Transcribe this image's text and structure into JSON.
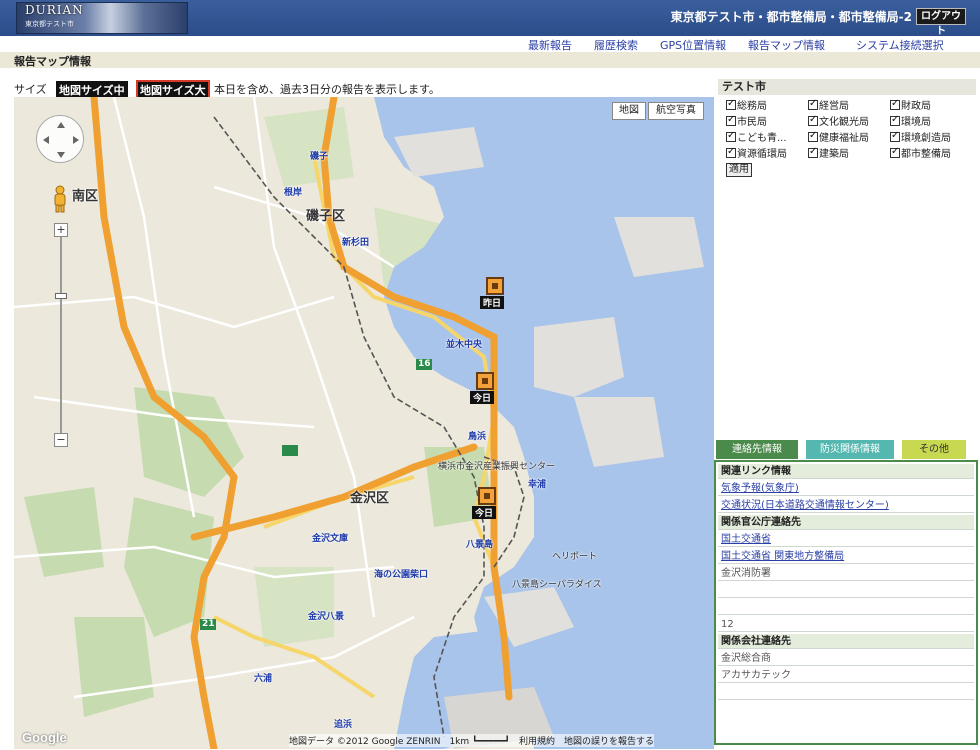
{
  "header": {
    "logo_text": "DURIAN",
    "logo_sub": "東京都テスト市",
    "title": "東京都テスト市・都市整備局・都市整備局-2",
    "logout": "ログアウト"
  },
  "nav": {
    "items": [
      "最新報告",
      "履歴検索",
      "GPS位置情報",
      "報告マップ情報",
      "システム接続選択"
    ]
  },
  "page_title": "報告マップ情報",
  "size_row": {
    "label": "サイズ",
    "medium": "地図サイズ中",
    "large": "地図サイズ大",
    "note": "本日を含め、過去3日分の報告を表示します。"
  },
  "map": {
    "toggle_map": "地図",
    "toggle_satellite": "航空写真",
    "zoom_in": "+",
    "zoom_out": "−",
    "google": "Google",
    "attribution": "地図データ ©2012 Google ZENRIN　1km ┗━━━━━┛　利用規約　地図の誤りを報告する",
    "labels": {
      "district_isogo": "磯子区",
      "district_kanazawa": "金沢区",
      "district_konan": "南区",
      "station_isogo": "磯子",
      "station_shinsugita": "新杉田",
      "station_negishi": "根岸",
      "station_kanazawabunko": "金沢文庫",
      "station_kanazawahakkei": "金沢八景",
      "station_namiki": "並木中央",
      "station_hakkeijima": "八景島",
      "station_umiNoKoen": "海の公園柴口",
      "station_torihama": "鳥浜",
      "station_sachiura": "幸浦",
      "station_rokuura": "六浦",
      "station_oppama": "追浜",
      "landmark_sea_paradise": "八景島シーパラダイス",
      "landmark_heliport": "ヘリポート",
      "landmark_center": "横浜市金沢産業振興センター",
      "route_16": "16",
      "route_21": "21"
    },
    "markers": [
      "昨日",
      "今日",
      "今日"
    ]
  },
  "test_city": {
    "title": "テスト市",
    "departments": [
      {
        "label": "総務局",
        "checked": true
      },
      {
        "label": "経営局",
        "checked": true
      },
      {
        "label": "財政局",
        "checked": true
      },
      {
        "label": "市民局",
        "checked": true
      },
      {
        "label": "文化観光局",
        "checked": true
      },
      {
        "label": "環境局",
        "checked": true
      },
      {
        "label": "こども青...",
        "checked": true
      },
      {
        "label": "健康福祉局",
        "checked": true
      },
      {
        "label": "環境創造局",
        "checked": true
      },
      {
        "label": "資源循環局",
        "checked": true
      },
      {
        "label": "建築局",
        "checked": true
      },
      {
        "label": "都市整備局",
        "checked": true
      }
    ],
    "apply": "適用"
  },
  "contacts": {
    "tabs": [
      "連絡先情報",
      "防災関係情報",
      "その他"
    ],
    "rows": [
      {
        "text": "関連リンク情報",
        "kind": "head"
      },
      {
        "text": "気象予報(気象庁)",
        "kind": "link"
      },
      {
        "text": "交通状況(日本道路交通情報センター)",
        "kind": "link"
      },
      {
        "text": "関係官公庁連絡先",
        "kind": "head"
      },
      {
        "text": "国土交通省",
        "kind": "link"
      },
      {
        "text": "国土交通省 関東地方整備局",
        "kind": "link"
      },
      {
        "text": "金沢消防署",
        "kind": "plain"
      },
      {
        "text": "",
        "kind": "plain"
      },
      {
        "text": "",
        "kind": "plain"
      },
      {
        "text": "12",
        "kind": "plain"
      },
      {
        "text": "関係会社連絡先",
        "kind": "head"
      },
      {
        "text": "金沢総合商",
        "kind": "plain"
      },
      {
        "text": "アカサカテック",
        "kind": "plain"
      },
      {
        "text": "",
        "kind": "plain"
      }
    ]
  },
  "colors": {
    "header_blue": "#2b4d8a",
    "nav_link": "#2b3fa5",
    "tab_green": "#4a8a4a",
    "tab_teal": "#55b8b0",
    "tab_yellow": "#c8d850",
    "sea": "#a9c4ea",
    "highway": "#f0a030",
    "marker": "#f3a23a"
  }
}
